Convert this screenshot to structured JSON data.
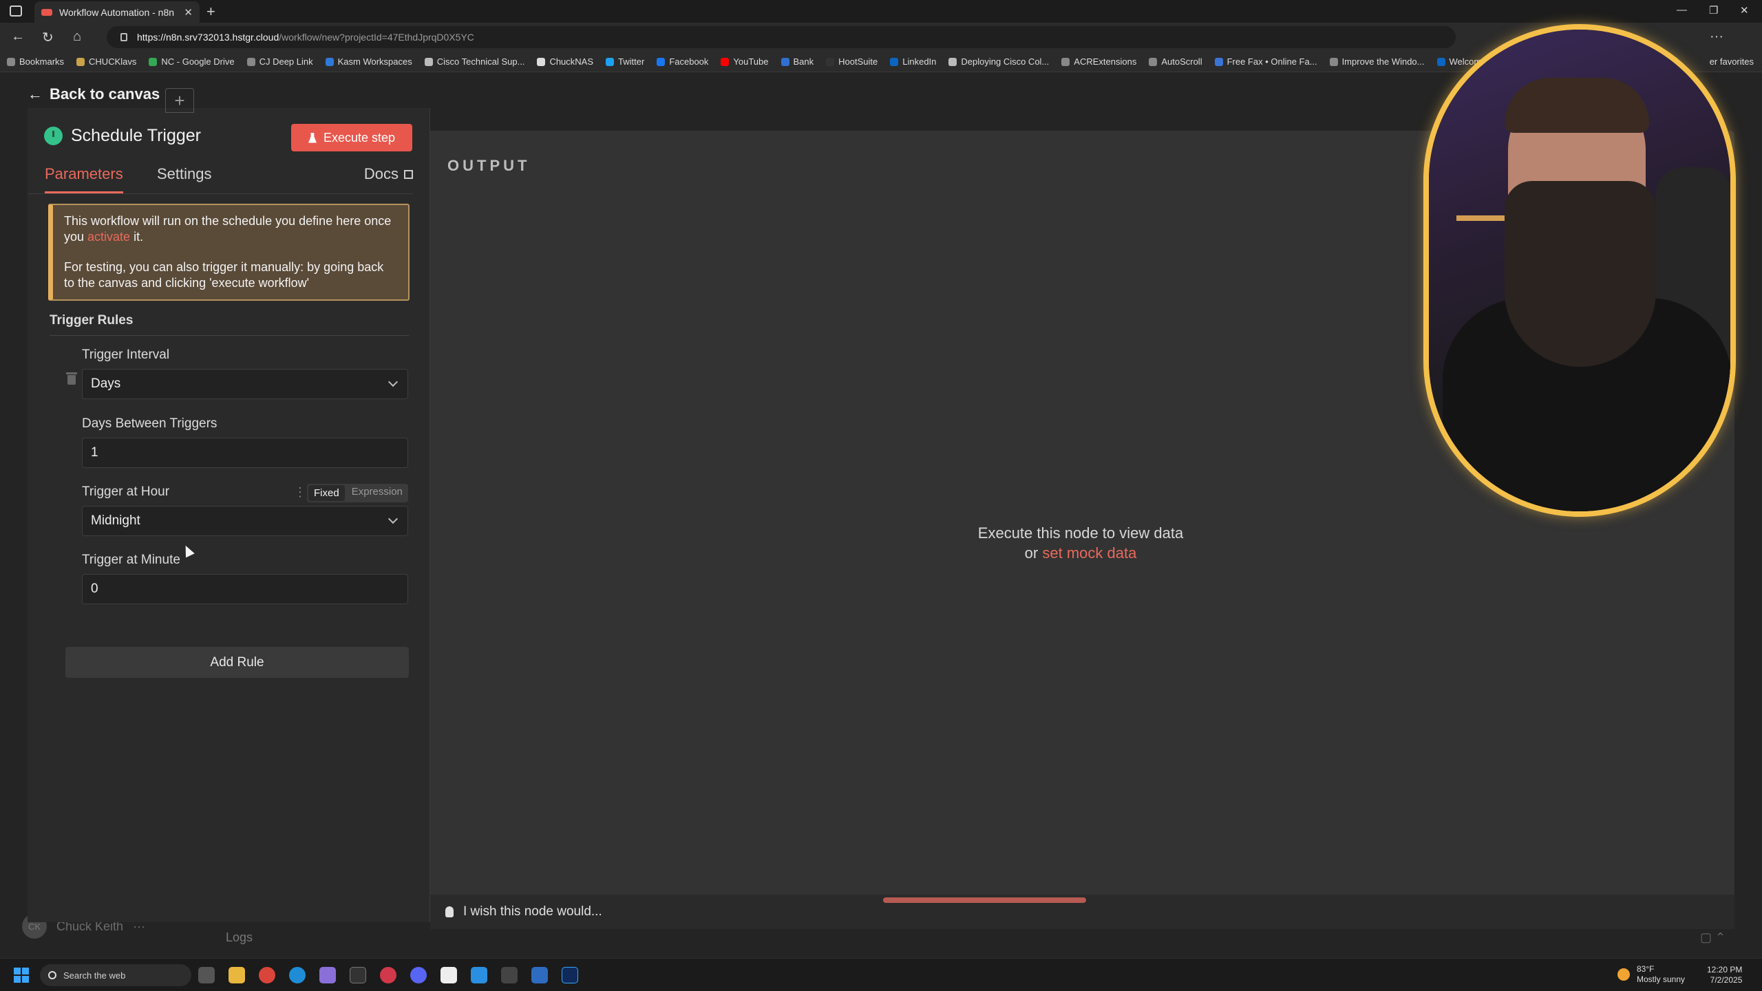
{
  "browser": {
    "tab_title": "Workflow Automation - n8n",
    "url_host": "https://n8n.srv732013.hstgr.cloud",
    "url_path": "/workflow/new?projectId=47EthdJprqD0X5YC",
    "bookmarks": [
      {
        "label": "Bookmarks",
        "icon": "globe-icon"
      },
      {
        "label": "CHUCKlavs",
        "icon": "folder-icon"
      },
      {
        "label": "NC - Google Drive",
        "icon": "drive-icon"
      },
      {
        "label": "CJ Deep Link",
        "icon": "globe-icon"
      },
      {
        "label": "Kasm Workspaces",
        "icon": "kasm-icon"
      },
      {
        "label": "Cisco Technical Sup...",
        "icon": "page-icon"
      },
      {
        "label": "ChuckNAS",
        "icon": "page-icon"
      },
      {
        "label": "Twitter",
        "icon": "twitter-icon"
      },
      {
        "label": "Facebook",
        "icon": "facebook-icon"
      },
      {
        "label": "YouTube",
        "icon": "youtube-icon"
      },
      {
        "label": "Bank",
        "icon": "bank-icon"
      },
      {
        "label": "HootSuite",
        "icon": "hootsuite-icon"
      },
      {
        "label": "LinkedIn",
        "icon": "linkedin-icon"
      },
      {
        "label": "Deploying Cisco Col...",
        "icon": "page-icon"
      },
      {
        "label": "ACRExtensions",
        "icon": "globe-icon"
      },
      {
        "label": "AutoScroll",
        "icon": "globe-icon"
      },
      {
        "label": "Free Fax • Online Fa...",
        "icon": "fax-icon"
      },
      {
        "label": "Improve the Windo...",
        "icon": "globe-icon"
      },
      {
        "label": "Welcome! | Linked",
        "icon": "linkedin-icon"
      }
    ],
    "other_favorites": "er favorites"
  },
  "ndv": {
    "back_label": "Back to canvas",
    "node_title": "Schedule Trigger",
    "execute_label": "Execute step",
    "tabs": {
      "parameters": "Parameters",
      "settings": "Settings",
      "docs": "Docs"
    },
    "notice": {
      "line1_before": "This workflow will run on the schedule you define here once you ",
      "line1_link": "activate",
      "line1_after": " it.",
      "line2": "For testing, you can also trigger it manually: by going back to the canvas and clicking 'execute workflow'"
    },
    "section_title": "Trigger Rules",
    "fields": {
      "interval_label": "Trigger Interval",
      "interval_value": "Days",
      "days_label": "Days Between Triggers",
      "days_value": "1",
      "hour_label": "Trigger at Hour",
      "hour_value": "Midnight",
      "mode_fixed": "Fixed",
      "mode_expression": "Expression",
      "minute_label": "Trigger at Minute",
      "minute_value": "0"
    },
    "add_rule": "Add Rule",
    "output": {
      "title": "OUTPUT",
      "message": "Execute this node to view data",
      "or": "or ",
      "mock_link": "set mock data"
    },
    "feedback": "I wish this node would..."
  },
  "background": {
    "user_initials": "CK",
    "user_name": "Chuck Keith",
    "logs": "Logs"
  },
  "taskbar": {
    "search_placeholder": "Search the web",
    "weather_temp": "83°F",
    "weather_desc": "Mostly sunny",
    "time": "12:20 PM",
    "date": "7/2/2025"
  },
  "colors": {
    "accent": "#e8574c",
    "link": "#ea6a5c",
    "trigger_icon": "#35c18a",
    "notice_border": "#e5b05c",
    "webcam_frame": "#f5c04a"
  }
}
